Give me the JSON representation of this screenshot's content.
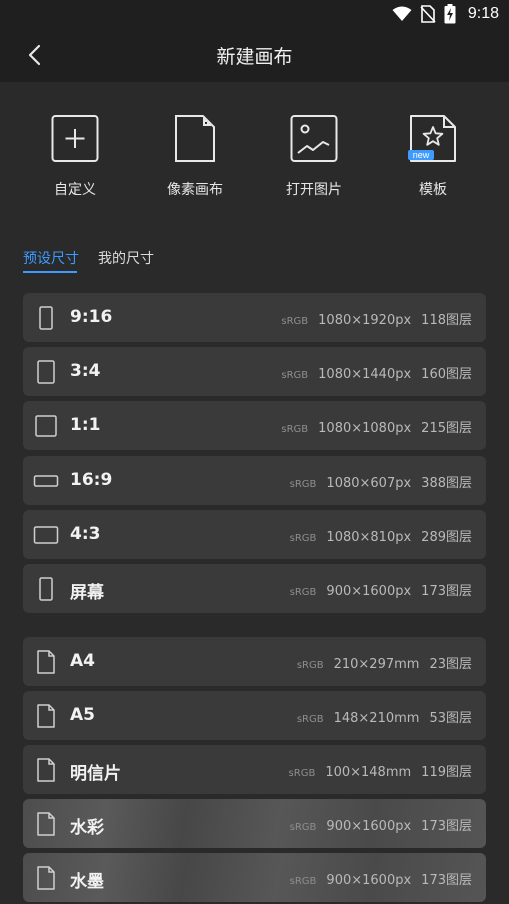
{
  "status_bar": {
    "time": "9:18",
    "icons": [
      "wifi-icon",
      "no-sim-icon",
      "battery-charging-icon"
    ]
  },
  "header": {
    "title": "新建画布",
    "back_icon": "chevron-left-icon"
  },
  "actions": [
    {
      "label": "自定义",
      "icon": "plus-square-icon"
    },
    {
      "label": "像素画布",
      "icon": "pixel-document-icon"
    },
    {
      "label": "打开图片",
      "icon": "image-icon"
    },
    {
      "label": "模板",
      "icon": "template-star-icon",
      "badge": "new"
    }
  ],
  "tabs": [
    {
      "label": "预设尺寸",
      "active": true
    },
    {
      "label": "我的尺寸",
      "active": false
    }
  ],
  "presets": [
    {
      "name": "9:16",
      "color_space": "sRGB",
      "size": "1080×1920px",
      "layers": "118图层",
      "icon": "portrait-tall-icon"
    },
    {
      "name": "3:4",
      "color_space": "sRGB",
      "size": "1080×1440px",
      "layers": "160图层",
      "icon": "portrait-icon"
    },
    {
      "name": "1:1",
      "color_space": "sRGB",
      "size": "1080×1080px",
      "layers": "215图层",
      "icon": "square-icon"
    },
    {
      "name": "16:9",
      "color_space": "sRGB",
      "size": "1080×607px",
      "layers": "388图层",
      "icon": "landscape-wide-icon"
    },
    {
      "name": "4:3",
      "color_space": "sRGB",
      "size": "1080×810px",
      "layers": "289图层",
      "icon": "landscape-icon"
    },
    {
      "name": "屏幕",
      "color_space": "sRGB",
      "size": "900×1600px",
      "layers": "173图层",
      "icon": "phone-screen-icon"
    }
  ],
  "papers": [
    {
      "name": "A4",
      "color_space": "sRGB",
      "size": "210×297mm",
      "layers": "23图层",
      "icon": "document-icon"
    },
    {
      "name": "A5",
      "color_space": "sRGB",
      "size": "148×210mm",
      "layers": "53图层",
      "icon": "document-icon"
    },
    {
      "name": "明信片",
      "color_space": "sRGB",
      "size": "100×148mm",
      "layers": "119图层",
      "icon": "document-icon"
    },
    {
      "name": "水彩",
      "color_space": "sRGB",
      "size": "900×1600px",
      "layers": "173图层",
      "icon": "document-icon",
      "textured": true
    },
    {
      "name": "水墨",
      "color_space": "sRGB",
      "size": "900×1600px",
      "layers": "173图层",
      "icon": "document-icon",
      "textured": true
    }
  ],
  "colors": {
    "accent": "#3d9bff",
    "background": "#2a2a2a",
    "row": "#3a3a3a",
    "bar": "#1f1f1f"
  }
}
